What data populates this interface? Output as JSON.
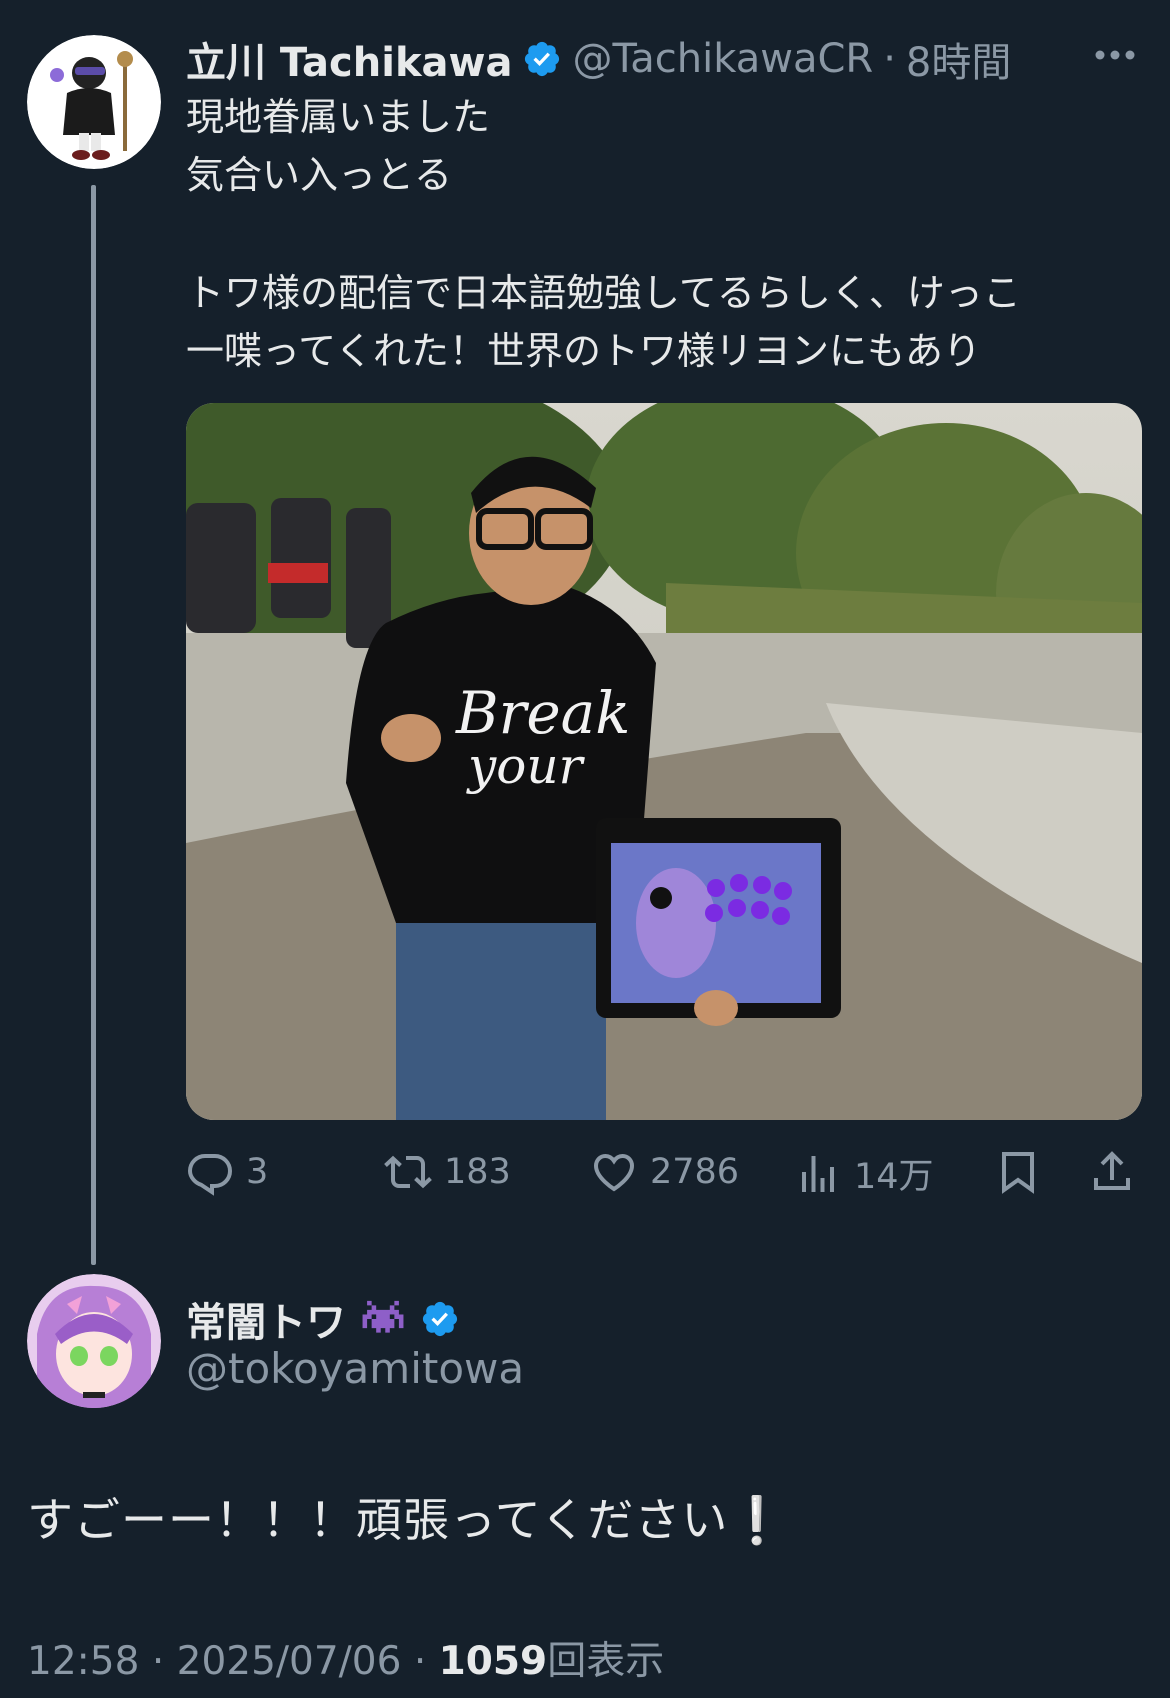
{
  "parent_tweet": {
    "display_name": "立川 Tachikawa",
    "handle": "@TachikawaCR",
    "separator": "·",
    "time_ago": "8時間",
    "more_icon": "ellipsis-icon",
    "text_lines": [
      "現地眷属いました",
      "気合い入っとる",
      "",
      "トワ様の配信で日本語勉強してるらしく、けっこ",
      "一喋ってくれた！世界のトワ様リヨンにもあり"
    ],
    "actions": {
      "reply_count": "3",
      "retweet_count": "183",
      "like_count": "2786",
      "view_count": "14万"
    }
  },
  "reply_tweet": {
    "display_name": "常闇トワ",
    "emoji": "👾",
    "handle": "@tokoyamitowa",
    "text": "すごーー！！！頑張ってください❕",
    "time": "12:58",
    "date": "2025/07/06",
    "separator": "·",
    "views_count": "1059",
    "views_label": "回表示"
  },
  "colors": {
    "background": "#15202b",
    "text": "#e7e9ea",
    "secondary": "#8b98a5",
    "verified": "#1d9bf0"
  }
}
